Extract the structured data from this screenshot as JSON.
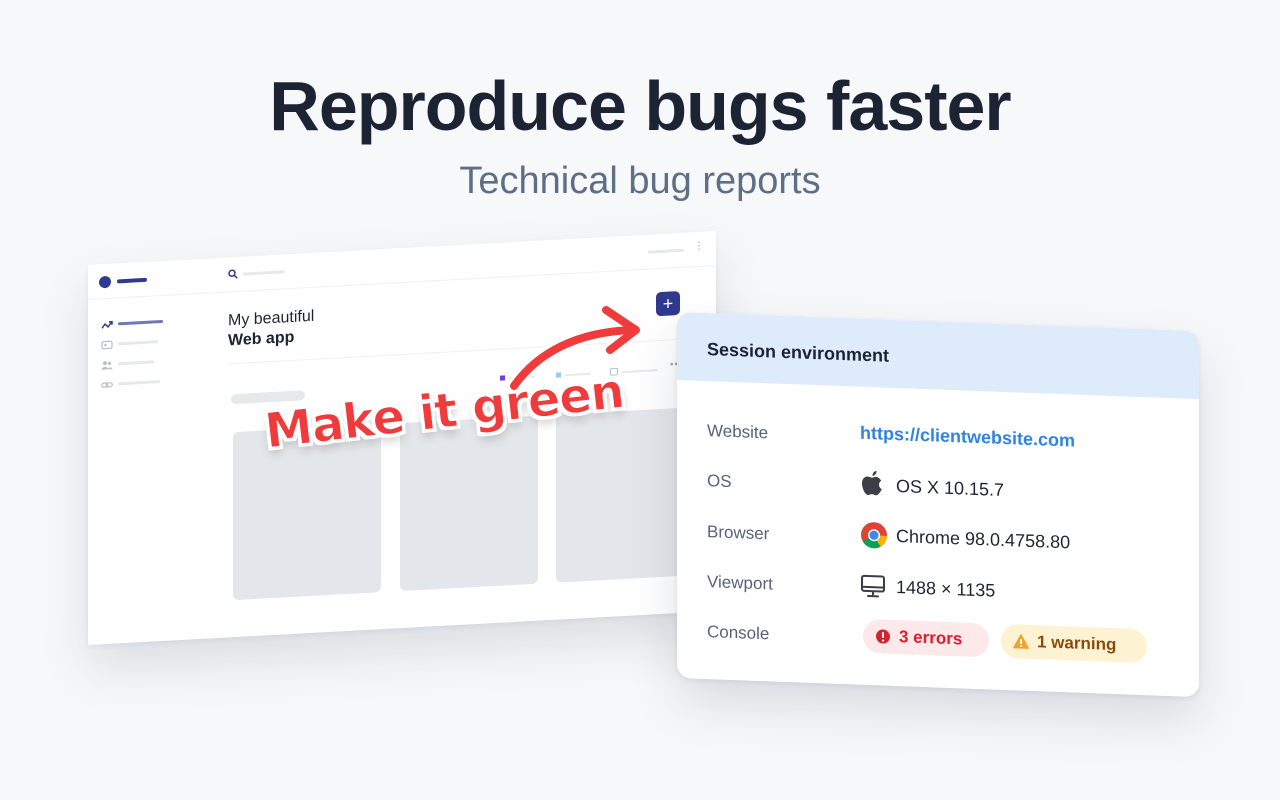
{
  "hero": {
    "title": "Reproduce bugs faster",
    "subtitle": "Technical bug reports"
  },
  "app_mock": {
    "title_line1": "My beautiful",
    "title_line2": "Web app",
    "add_button": "+",
    "top_menu": "⋮",
    "legend_colors": [
      "#6d3de0",
      "#9ccaf5",
      "#b9bec7"
    ],
    "accent": "#2f3a8f"
  },
  "annotation": {
    "text": "Make it green",
    "color": "#ef3b3b"
  },
  "session": {
    "header": "Session environment",
    "rows": [
      {
        "label": "Website",
        "value": "https://clientwebsite.com"
      },
      {
        "label": "OS",
        "value": "OS X 10.15.7",
        "icon": "apple-icon"
      },
      {
        "label": "Browser",
        "value": "Chrome 98.0.4758.80",
        "icon": "chrome-icon"
      },
      {
        "label": "Viewport",
        "value": "1488 × 1135",
        "icon": "monitor-icon"
      },
      {
        "label": "Console",
        "errors": "3 errors",
        "warnings": "1 warning"
      }
    ],
    "colors": {
      "header_bg": "#deebfb",
      "link": "#2f84e0",
      "error": "#d8202f",
      "warning": "#f0a22a"
    }
  }
}
